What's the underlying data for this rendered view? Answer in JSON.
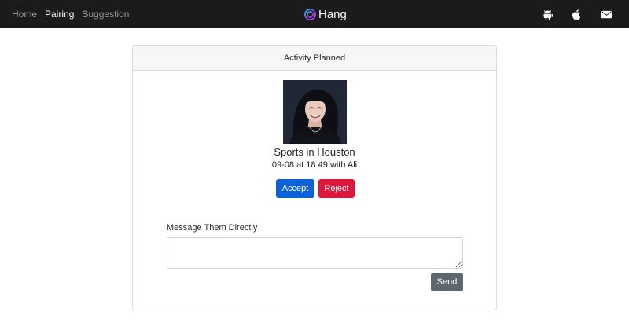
{
  "nav": {
    "links": [
      {
        "label": "Home",
        "active": false
      },
      {
        "label": "Pairing",
        "active": true
      },
      {
        "label": "Suggestion",
        "active": false
      }
    ],
    "brand": "Hang",
    "icons": [
      "android-icon",
      "apple-icon",
      "mail-icon"
    ]
  },
  "card": {
    "header": "Activity Planned",
    "title": "Sports in Houston",
    "meta": "09-08 at 18:49 with Ali",
    "accept_label": "Accept",
    "reject_label": "Reject",
    "message_label": "Message Them Directly",
    "message_value": "",
    "send_label": "Send"
  },
  "colors": {
    "navbar": "#1b1b1b",
    "accept": "#0d62d9",
    "reject": "#e0173d",
    "send": "#5f676e"
  }
}
